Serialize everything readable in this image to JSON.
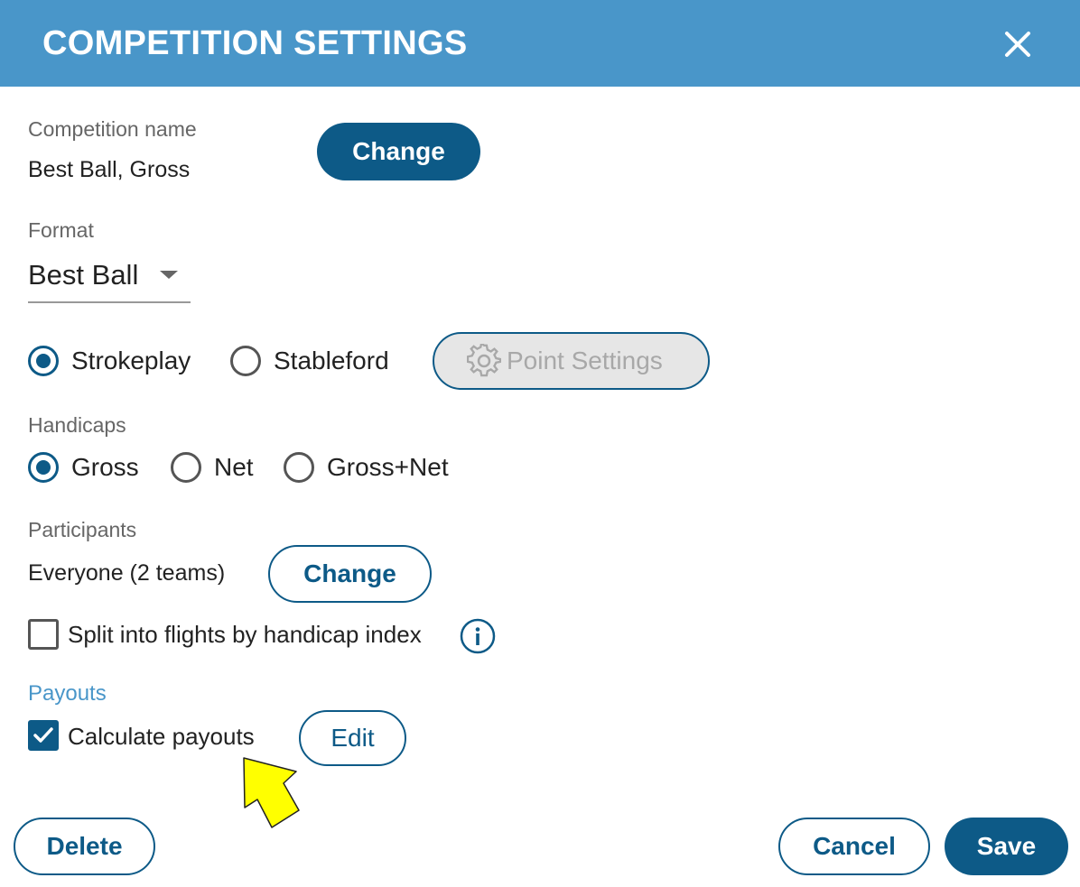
{
  "header": {
    "title": "COMPETITION SETTINGS",
    "close_icon": "close-icon"
  },
  "competition_name": {
    "label": "Competition name",
    "value": "Best Ball, Gross",
    "change_label": "Change"
  },
  "format": {
    "label": "Format",
    "selected": "Best Ball"
  },
  "scoring": {
    "options": [
      {
        "label": "Strokeplay",
        "checked": true
      },
      {
        "label": "Stableford",
        "checked": false
      }
    ],
    "point_settings_label": "Point Settings",
    "point_settings_icon": "gear-icon"
  },
  "handicaps": {
    "label": "Handicaps",
    "options": [
      {
        "label": "Gross",
        "checked": true
      },
      {
        "label": "Net",
        "checked": false
      },
      {
        "label": "Gross+Net",
        "checked": false
      }
    ]
  },
  "participants": {
    "label": "Participants",
    "value": "Everyone (2 teams)",
    "change_label": "Change",
    "split_label": "Split into flights by handicap index",
    "split_checked": false,
    "info_icon": "info-icon"
  },
  "payouts": {
    "label": "Payouts",
    "calculate_label": "Calculate payouts",
    "calculate_checked": true,
    "edit_label": "Edit"
  },
  "footer": {
    "delete_label": "Delete",
    "cancel_label": "Cancel",
    "save_label": "Save"
  },
  "colors": {
    "header": "#4996c9",
    "primary": "#0d5a87",
    "pointer_arrow": "#ffff00"
  }
}
